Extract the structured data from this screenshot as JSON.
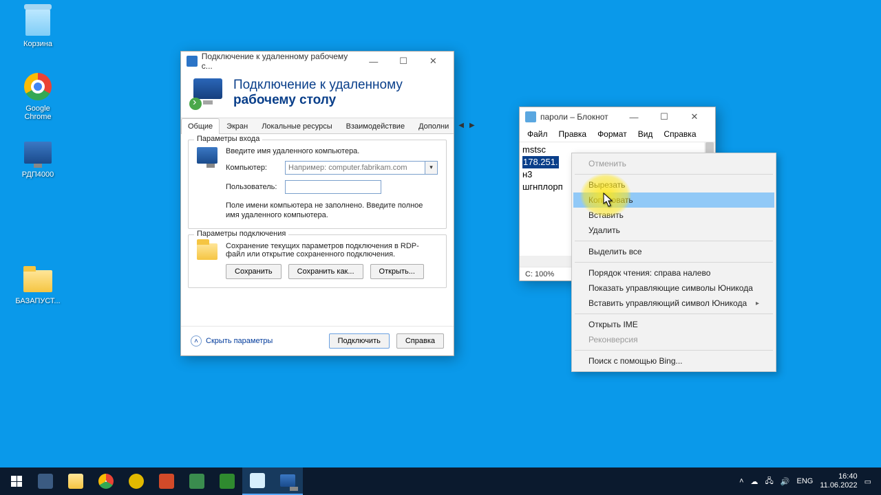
{
  "desktop": {
    "icons": [
      {
        "name": "Корзина"
      },
      {
        "name": "Google Chrome"
      },
      {
        "name": "РДП4000"
      },
      {
        "name": "БАЗАПУСТ..."
      }
    ]
  },
  "rdp": {
    "title": "Подключение к удаленному рабочему с...",
    "banner_line1": "Подключение к удаленному",
    "banner_line2": "рабочему столу",
    "tabs": [
      "Общие",
      "Экран",
      "Локальные ресурсы",
      "Взаимодействие",
      "Дополни"
    ],
    "login_group": "Параметры входа",
    "login_prompt": "Введите имя удаленного компьютера.",
    "computer_label": "Компьютер:",
    "computer_placeholder": "Например: computer.fabrikam.com",
    "user_label": "Пользователь:",
    "hint": "Поле имени компьютера не заполнено. Введите полное имя удаленного компьютера.",
    "conn_group": "Параметры подключения",
    "conn_text": "Сохранение текущих параметров подключения в RDP-файл или открытие сохраненного подключения.",
    "save": "Сохранить",
    "saveas": "Сохранить как...",
    "open": "Открыть...",
    "hide": "Скрыть параметры",
    "connect": "Подключить",
    "help": "Справка"
  },
  "notepad": {
    "title": "пароли – Блокнот",
    "menu": [
      "Файл",
      "Правка",
      "Формат",
      "Вид",
      "Справка"
    ],
    "lines": {
      "l1": "mstsc",
      "l2_sel": "178.251.",
      "l3": "н3",
      "l4": "шгнплорп"
    },
    "zoom": "С: 100%"
  },
  "ctx": {
    "undo": "Отменить",
    "cut": "Вырезать",
    "copy": "Копировать",
    "paste": "Вставить",
    "delete": "Удалить",
    "selectall": "Выделить все",
    "rtl": "Порядок чтения: справа налево",
    "show_unicode": "Показать управляющие символы Юникода",
    "insert_unicode": "Вставить управляющий символ Юникода",
    "ime": "Открыть IME",
    "reconv": "Реконверсия",
    "bing": "Поиск с помощью Bing..."
  },
  "taskbar": {
    "lang": "ENG",
    "time": "16:40",
    "date": "11.06.2022"
  }
}
